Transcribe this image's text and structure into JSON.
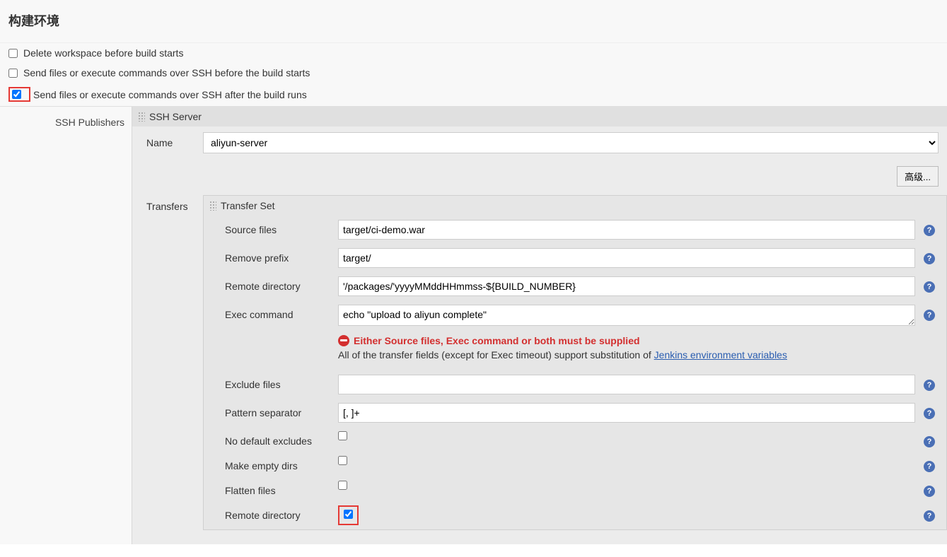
{
  "section": {
    "title": "构建环境"
  },
  "env_options": [
    {
      "label": "Delete workspace before build starts",
      "checked": false,
      "highlight": false
    },
    {
      "label": "Send files or execute commands over SSH before the build starts",
      "checked": false,
      "highlight": false
    },
    {
      "label": "Send files or execute commands over SSH after the build runs",
      "checked": true,
      "highlight": true
    }
  ],
  "ssh_publishers_label": "SSH Publishers",
  "ssh_server": {
    "header": "SSH Server",
    "name_label": "Name",
    "name_value": "aliyun-server",
    "advanced_button": "高级..."
  },
  "transfers_label": "Transfers",
  "transfer_set": {
    "header": "Transfer Set",
    "source_files": {
      "label": "Source files",
      "value": "target/ci-demo.war"
    },
    "remove_prefix": {
      "label": "Remove prefix",
      "value": "target/"
    },
    "remote_directory": {
      "label": "Remote directory",
      "value": "'/packages/'yyyyMMddHHmmss-${BUILD_NUMBER}"
    },
    "exec_command": {
      "label": "Exec command",
      "value": "echo \"upload to aliyun complete\""
    },
    "error_message": "Either Source files, Exec command or both must be supplied",
    "note_prefix": "All of the transfer fields (except for Exec timeout) support substitution of ",
    "note_link": "Jenkins environment variables",
    "exclude_files": {
      "label": "Exclude files",
      "value": ""
    },
    "pattern_separator": {
      "label": "Pattern separator",
      "value": "[, ]+"
    },
    "no_default_excludes": {
      "label": "No default excludes",
      "checked": false
    },
    "make_empty_dirs": {
      "label": "Make empty dirs",
      "checked": false
    },
    "flatten_files": {
      "label": "Flatten files",
      "checked": false
    },
    "remote_directory_cb": {
      "label": "Remote directory",
      "checked": true,
      "highlight": true
    }
  }
}
